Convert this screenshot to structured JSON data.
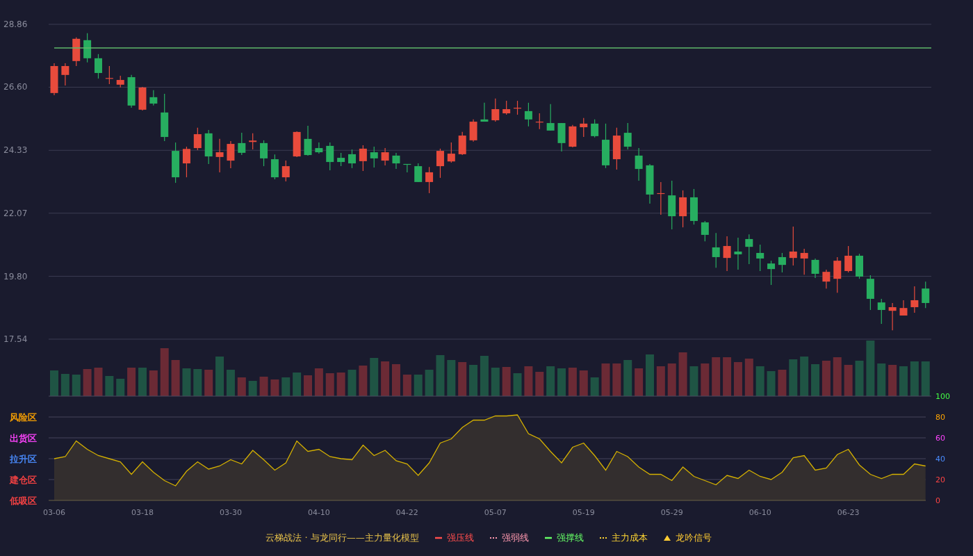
{
  "price_chart": {
    "chart_data": {
      "type": "candlestick",
      "categories": [
        null,
        null,
        null,
        null,
        null,
        null,
        null,
        null,
        null,
        null,
        null,
        null,
        null,
        null,
        null,
        null,
        null,
        null,
        null,
        null,
        null,
        null,
        null,
        null,
        null,
        null,
        null,
        null,
        null,
        null,
        null,
        null,
        null,
        null,
        null,
        null,
        null,
        null,
        null,
        null,
        null,
        null,
        null,
        null,
        null,
        null,
        null,
        null,
        null,
        null,
        null,
        null,
        null,
        null,
        null,
        null,
        null,
        null,
        null,
        null,
        null,
        null,
        null,
        null,
        null,
        null,
        null,
        null,
        null,
        null,
        null,
        null,
        null,
        null,
        null,
        null,
        null,
        null,
        null,
        null
      ],
      "ohlc": [
        [
          26.39,
          27.46,
          26.31,
          27.36
        ],
        [
          27.04,
          27.46,
          26.66,
          27.36
        ],
        [
          27.54,
          28.39,
          27.36,
          28.34
        ],
        [
          28.29,
          28.54,
          27.49,
          27.64
        ],
        [
          27.64,
          27.79,
          26.91,
          27.11
        ],
        [
          26.91,
          27.36,
          26.71,
          26.93
        ],
        [
          26.69,
          27.01,
          26.59,
          26.86
        ],
        [
          26.96,
          27.04,
          25.86,
          25.94
        ],
        [
          25.79,
          26.61,
          25.76,
          26.59
        ],
        [
          26.24,
          26.49,
          25.94,
          26.01
        ],
        [
          25.69,
          26.36,
          24.66,
          24.81
        ],
        [
          24.31,
          24.61,
          23.16,
          23.36
        ],
        [
          23.86,
          24.46,
          23.36,
          24.38
        ],
        [
          24.41,
          25.14,
          24.34,
          24.91
        ],
        [
          24.94,
          25.06,
          23.84,
          24.11
        ],
        [
          24.09,
          24.74,
          23.54,
          24.26
        ],
        [
          23.96,
          24.66,
          23.69,
          24.56
        ],
        [
          24.59,
          24.96,
          24.16,
          24.24
        ],
        [
          24.63,
          24.94,
          24.36,
          24.68
        ],
        [
          24.59,
          24.69,
          23.76,
          24.04
        ],
        [
          24.01,
          24.18,
          23.29,
          23.36
        ],
        [
          23.36,
          23.96,
          23.21,
          23.76
        ],
        [
          24.11,
          25.01,
          24.09,
          24.99
        ],
        [
          24.74,
          25.21,
          24.14,
          24.16
        ],
        [
          24.41,
          24.61,
          24.21,
          24.26
        ],
        [
          24.49,
          24.61,
          23.61,
          23.91
        ],
        [
          24.06,
          24.24,
          23.76,
          23.91
        ],
        [
          24.19,
          24.36,
          23.69,
          23.86
        ],
        [
          23.94,
          24.51,
          23.59,
          24.39
        ],
        [
          24.26,
          24.46,
          23.71,
          24.04
        ],
        [
          23.96,
          24.41,
          23.79,
          24.26
        ],
        [
          24.14,
          24.24,
          23.66,
          23.86
        ],
        [
          23.84,
          23.84,
          23.54,
          23.81
        ],
        [
          23.76,
          23.86,
          23.19,
          23.19
        ],
        [
          23.19,
          23.73,
          22.79,
          23.54
        ],
        [
          23.76,
          24.39,
          23.34,
          24.31
        ],
        [
          23.93,
          24.61,
          23.89,
          24.21
        ],
        [
          24.19,
          24.99,
          24.16,
          24.86
        ],
        [
          24.69,
          25.44,
          24.64,
          25.36
        ],
        [
          25.44,
          26.04,
          25.36,
          25.36
        ],
        [
          25.41,
          26.19,
          25.36,
          25.81
        ],
        [
          25.66,
          26.11,
          25.61,
          25.81
        ],
        [
          25.83,
          26.11,
          25.61,
          25.86
        ],
        [
          25.74,
          26.04,
          25.19,
          25.44
        ],
        [
          25.35,
          25.66,
          25.09,
          25.36
        ],
        [
          25.31,
          25.99,
          25.04,
          25.04
        ],
        [
          25.31,
          25.31,
          24.29,
          24.59
        ],
        [
          24.46,
          25.24,
          24.44,
          25.19
        ],
        [
          25.16,
          25.49,
          24.81,
          25.29
        ],
        [
          25.29,
          25.44,
          24.79,
          24.84
        ],
        [
          24.71,
          25.29,
          23.69,
          23.79
        ],
        [
          24.01,
          25.14,
          23.64,
          24.86
        ],
        [
          24.96,
          25.31,
          24.36,
          24.46
        ],
        [
          24.14,
          24.41,
          23.24,
          23.66
        ],
        [
          23.79,
          23.84,
          22.41,
          22.74
        ],
        [
          22.76,
          23.19,
          22.01,
          22.79
        ],
        [
          22.71,
          23.24,
          21.49,
          21.96
        ],
        [
          21.96,
          22.89,
          21.56,
          22.64
        ],
        [
          22.64,
          22.94,
          21.66,
          21.79
        ],
        [
          21.74,
          21.79,
          21.06,
          21.29
        ],
        [
          20.84,
          21.36,
          20.11,
          20.49
        ],
        [
          20.46,
          21.24,
          19.99,
          20.89
        ],
        [
          20.69,
          21.19,
          20.04,
          20.59
        ],
        [
          21.14,
          21.31,
          20.24,
          20.86
        ],
        [
          20.64,
          20.94,
          19.99,
          20.44
        ],
        [
          20.26,
          20.36,
          19.49,
          20.06
        ],
        [
          20.49,
          20.64,
          19.94,
          20.21
        ],
        [
          20.46,
          21.59,
          20.19,
          20.69
        ],
        [
          20.44,
          20.79,
          19.86,
          20.64
        ],
        [
          20.39,
          20.44,
          19.74,
          19.89
        ],
        [
          19.61,
          20.04,
          19.36,
          19.96
        ],
        [
          19.71,
          20.49,
          19.21,
          20.36
        ],
        [
          19.99,
          20.89,
          19.94,
          20.54
        ],
        [
          20.54,
          20.61,
          19.71,
          19.79
        ],
        [
          19.71,
          19.84,
          18.59,
          18.99
        ],
        [
          18.86,
          18.99,
          18.09,
          18.59
        ],
        [
          18.56,
          18.84,
          17.86,
          18.69
        ],
        [
          18.39,
          18.94,
          18.39,
          18.66
        ],
        [
          18.69,
          19.44,
          18.49,
          18.94
        ],
        [
          19.36,
          19.61,
          18.66,
          18.84
        ]
      ],
      "ylim": [
        17.54,
        28.86
      ],
      "yticks": [
        17.54,
        {
          "value": 19.8,
          "label": "19.80"
        },
        22.07,
        24.33,
        {
          "value": 26.6,
          "label": "26.60"
        },
        28.86
      ],
      "grid": true
    }
  },
  "indicator": {
    "zones": [
      {
        "label": "风险区",
        "color": "#ffa500"
      },
      {
        "label": "出货区",
        "color": "#ff44ff"
      },
      {
        "label": "拉升区",
        "color": "#4a8cff"
      },
      {
        "label": "建仓区",
        "color": "#ff4444"
      },
      {
        "label": "低吸区",
        "color": "#ff4444"
      }
    ],
    "tick_marks": [
      {
        "color": "#ff4444"
      },
      {
        "color": "#ff4444"
      },
      {
        "color": "#4a8cff"
      },
      {
        "color": "#ff44ff"
      },
      {
        "color": "#ffa500"
      },
      {
        "color": "#44ff44"
      }
    ],
    "chart_data": {
      "type": "area",
      "grid": true,
      "categories": [
        "03-06",
        null,
        null,
        null,
        null,
        null,
        null,
        null,
        "03-18",
        null,
        null,
        null,
        null,
        null,
        null,
        null,
        "03-30",
        null,
        null,
        null,
        null,
        null,
        null,
        null,
        "04-10",
        null,
        null,
        null,
        null,
        null,
        null,
        null,
        "04-22",
        null,
        null,
        null,
        null,
        null,
        null,
        null,
        "05-07",
        null,
        null,
        null,
        null,
        null,
        null,
        null,
        "05-19",
        null,
        null,
        null,
        null,
        null,
        null,
        null,
        "05-29",
        null,
        null,
        null,
        null,
        null,
        null,
        null,
        "06-10",
        null,
        null,
        null,
        null,
        null,
        null,
        null,
        "06-23",
        null,
        null,
        null,
        null,
        null,
        null,
        null
      ],
      "values": [
        40,
        42,
        57,
        49,
        43,
        40,
        37,
        25,
        37,
        27,
        19,
        14,
        28,
        37,
        30,
        33,
        39,
        35,
        48,
        39,
        29,
        36,
        57,
        47,
        49,
        42,
        40,
        39,
        53,
        43,
        48,
        38,
        35,
        24,
        36,
        55,
        59,
        70,
        77,
        77,
        81,
        81,
        82,
        64,
        59,
        47,
        36,
        51,
        55,
        43,
        29,
        47,
        42,
        32,
        25,
        25,
        19,
        32,
        23,
        19,
        15,
        24,
        21,
        29,
        23,
        20,
        27,
        41,
        43,
        29,
        31,
        44,
        49,
        34,
        25,
        21,
        25,
        25,
        35,
        33
      ],
      "ylim": [
        0,
        100
      ],
      "yticks": [
        0,
        20,
        40,
        60,
        80,
        100
      ]
    }
  },
  "legend": {
    "title": "云梯战法 · 与龙同行——主力量化模型",
    "items": [
      {
        "label": "强压线",
        "kind": "solid",
        "color": "#ff4d4d"
      },
      {
        "label": "强弱线",
        "kind": "dashed",
        "color": "#ff99b0"
      },
      {
        "label": "强撑线",
        "kind": "solid",
        "color": "#66ff66"
      },
      {
        "label": "主力成本",
        "kind": "dashed",
        "color": "#ffd633"
      },
      {
        "label": "龙吟信号",
        "kind": "marker",
        "color": "#ffcc33"
      }
    ]
  }
}
